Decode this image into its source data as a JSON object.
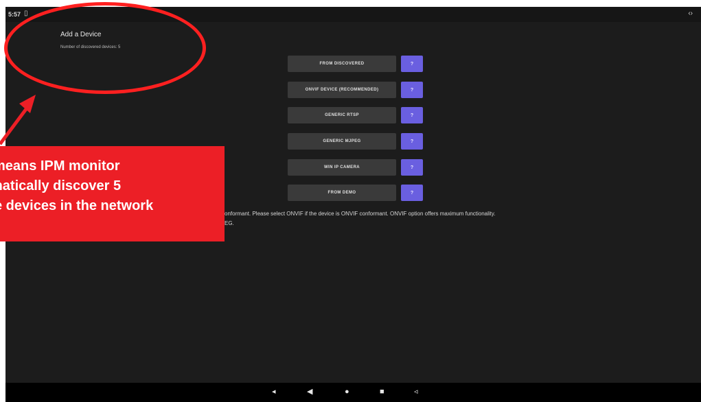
{
  "status_bar": {
    "time": "5:57",
    "left_icon": "sim-icon",
    "right_icon": "code-icon"
  },
  "header": {
    "title": "Add a Device",
    "discovered_text": "Number of discovered devices: 5"
  },
  "options": [
    {
      "label": "FROM DISCOVERED",
      "help": "?"
    },
    {
      "label": "ONVIF DEVICE (RECOMMENDED)",
      "help": "?"
    },
    {
      "label": "GENERIC RTSP",
      "help": "?"
    },
    {
      "label": "GENERIC MJPEG",
      "help": "?"
    },
    {
      "label": "WIN IP CAMERA",
      "help": "?"
    },
    {
      "label": "FROM DEMO",
      "help": "?"
    }
  ],
  "info_text": {
    "line1": "onformant. Please select ONVIF if the device is ONVIF conformant. ONVIF option offers maximum functionality.",
    "line2": "EG."
  },
  "nav_bar": {
    "icons": [
      "volume-down-icon",
      "back-icon",
      "home-icon",
      "recents-icon",
      "volume-up-icon"
    ]
  },
  "annotation": {
    "line1": "means IPM monitor",
    "line2": "matically discover 5",
    "line3": "e devices in the network"
  },
  "colors": {
    "accent": "#6a5fe0",
    "callout": "#ec1f26",
    "background": "#1c1c1c"
  }
}
